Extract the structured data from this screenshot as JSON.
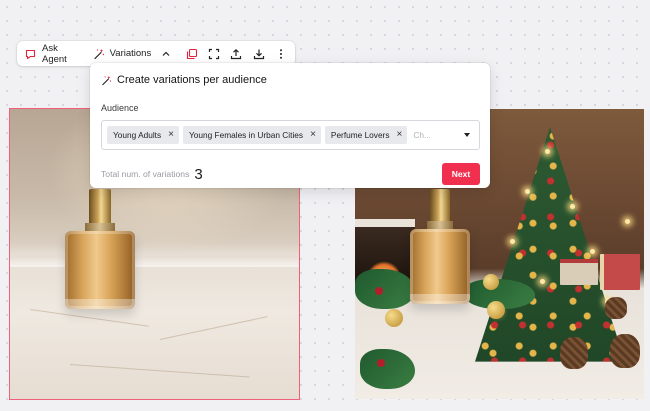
{
  "toolbar": {
    "ask_agent_label": "Ask Agent",
    "variations_label": "Variations",
    "icons": [
      "ask-agent-icon",
      "magic-wand-icon",
      "chevron-up-icon",
      "duplicate-icon",
      "fullscreen-icon",
      "upload-icon",
      "download-icon",
      "more-vertical-icon"
    ]
  },
  "popover": {
    "title": "Create variations per audience",
    "audience_label": "Audience",
    "chips": [
      {
        "label": "Young Adults"
      },
      {
        "label": "Young Females in Urban Cities"
      },
      {
        "label": "Perfume Lovers"
      }
    ],
    "chip_remove_glyph": "×",
    "input_placeholder": "Ch...",
    "total_label": "Total num. of variations",
    "total_value": "3",
    "next_label": "Next"
  },
  "colors": {
    "accent": "#f0304e",
    "selection_outline": "#f0607a",
    "chip_bg": "#e8e9ed"
  }
}
